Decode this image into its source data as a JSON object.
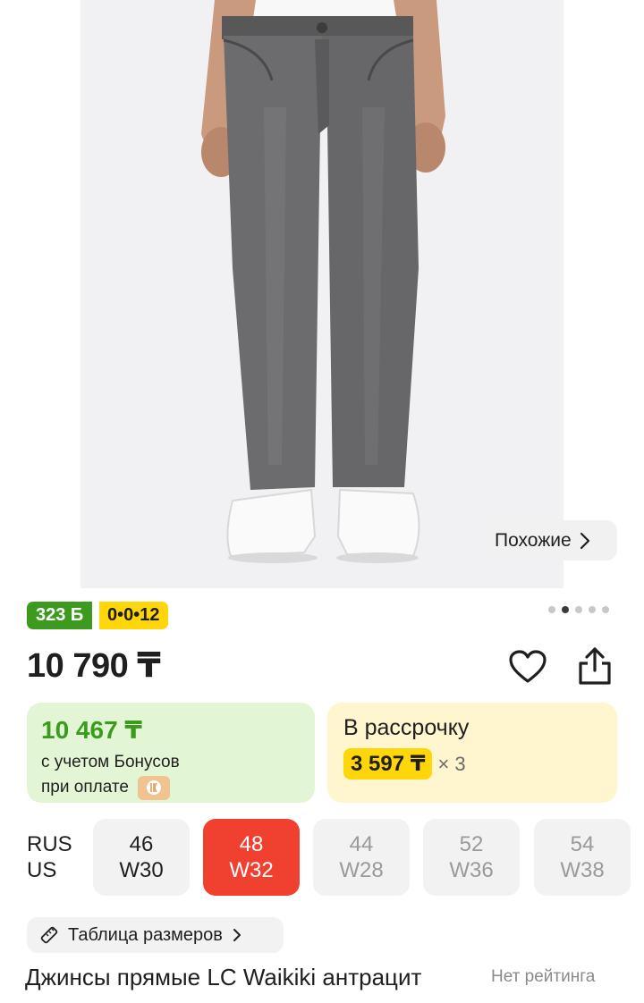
{
  "gallery": {
    "similar_label": "Похожие",
    "dots_count": 5,
    "active_dot": 1
  },
  "badges": {
    "bonus_points": "323 Б",
    "installment": "0•0•12"
  },
  "price": {
    "current": "10 790 ₸"
  },
  "bonus_offer": {
    "amount": "10 467 ₸",
    "line1": "с учетом Бонусов",
    "line2": "при оплате"
  },
  "installment_offer": {
    "title": "В рассрочку",
    "monthly": "3 597 ₸",
    "multiplier": "× 3"
  },
  "sizes": {
    "label_rus": "RUS",
    "label_us": "US",
    "options": [
      {
        "rus": "46",
        "us": "W30",
        "state": "available"
      },
      {
        "rus": "48",
        "us": "W32",
        "state": "selected"
      },
      {
        "rus": "44",
        "us": "W28",
        "state": "unavailable"
      },
      {
        "rus": "52",
        "us": "W36",
        "state": "unavailable"
      },
      {
        "rus": "54",
        "us": "W38",
        "state": "unavailable"
      }
    ]
  },
  "size_table": {
    "label": "Таблица размеров"
  },
  "product": {
    "title": "Джинсы прямые LC Waikiki антрацит",
    "rating": "Нет рейтинга"
  },
  "colors": {
    "green": "#3c9b1f",
    "yellow": "#ffd60a",
    "red": "#ef4030",
    "green_bg": "#e2f6d6",
    "yellow_bg": "#fff6cf"
  }
}
